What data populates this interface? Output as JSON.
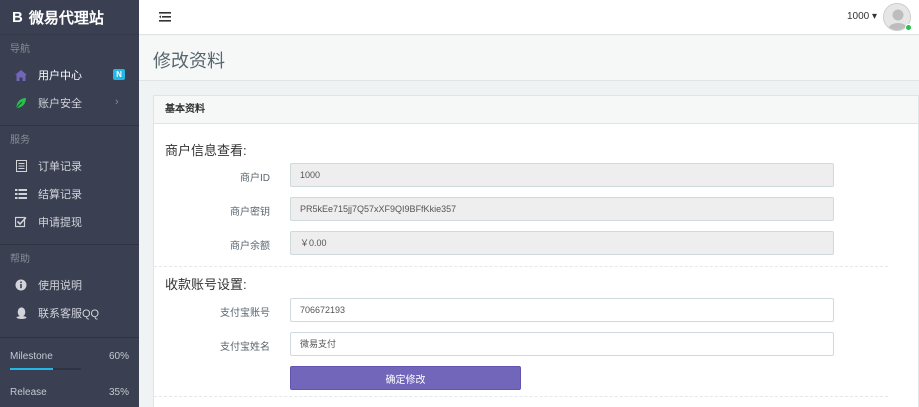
{
  "brand": {
    "logo": "B",
    "name": "微易代理站"
  },
  "sidebar": {
    "sections": [
      {
        "header": "导航",
        "items": [
          {
            "label": "用户中心",
            "icon": "home-icon",
            "badge": "N"
          },
          {
            "label": "账户安全",
            "icon": "leaf-icon",
            "chevron": "›"
          }
        ]
      },
      {
        "header": "服务",
        "items": [
          {
            "label": "订单记录",
            "icon": "document-icon"
          },
          {
            "label": "结算记录",
            "icon": "list-icon"
          },
          {
            "label": "申请提现",
            "icon": "checkbox-icon"
          }
        ]
      },
      {
        "header": "帮助",
        "items": [
          {
            "label": "使用说明",
            "icon": "info-icon"
          },
          {
            "label": "联系客服QQ",
            "icon": "qq-icon"
          }
        ]
      }
    ],
    "progress": [
      {
        "label": "Milestone",
        "percent_text": "60%",
        "value": 60
      },
      {
        "label": "Release",
        "percent_text": "35%",
        "value": 35
      }
    ]
  },
  "header": {
    "user_name": "1000 ▾"
  },
  "page": {
    "title": "修改资料"
  },
  "panel": {
    "heading": "基本资料",
    "merchant_section": "商户信息查看:",
    "merchant_fields": [
      {
        "label": "商户ID",
        "value": "1000"
      },
      {
        "label": "商户密钥",
        "value": "PR5kEe715jj7Q57xXF9QI9BFfKkie357"
      },
      {
        "label": "商户余额",
        "value": "￥0.00"
      }
    ],
    "payee_section": "收款账号设置:",
    "payee_fields": [
      {
        "label": "支付宝账号",
        "value": "706672193"
      },
      {
        "label": "支付宝姓名",
        "value": "微易支付"
      }
    ],
    "submit_label": "确定修改"
  },
  "colors": {
    "sidebar_bg": "#3a3f51",
    "accent": "#7266ba",
    "badge": "#23b7e5",
    "online": "#27c24c"
  }
}
